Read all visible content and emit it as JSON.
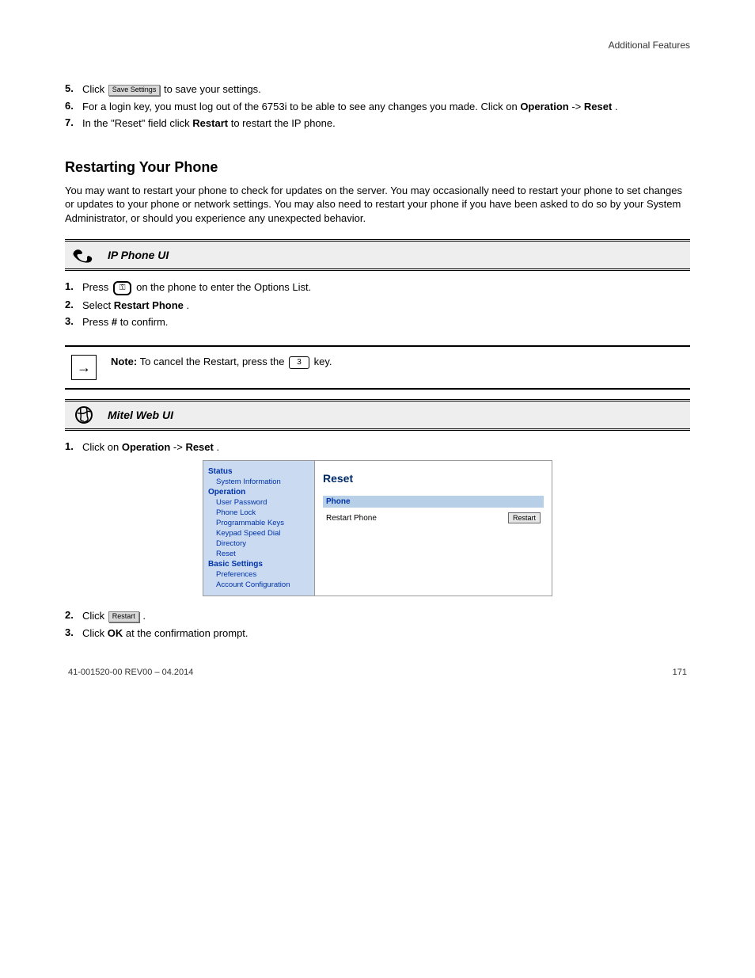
{
  "running_header": "Additional Features",
  "steps_a": [
    {
      "n": "5.",
      "pre": "Click ",
      "btn": "Save Settings",
      "post": " to save your settings."
    },
    {
      "n": "6.",
      "pre": "For a login key, you must log out of the 6753i to be able to see any changes you made. Click on ",
      "strong1": "Operation",
      "mid": "->",
      "strong2": "Reset",
      "post": "."
    },
    {
      "n": "7.",
      "pre": "In the \"Reset\" field click ",
      "strong1": "Restart",
      "post": " to restart the IP phone."
    }
  ],
  "section1": {
    "title": "Restarting Your Phone",
    "desc": "You may want to restart your phone to check for updates on the server. You may occasionally need to restart your phone to set changes or updates to your phone or network settings. You may also need to restart your phone if you have been asked to do so by your System Administrator, or should you experience any unexpected behavior."
  },
  "banner_phone": "IP Phone UI",
  "phone_steps": [
    {
      "n": "1.",
      "pre": "Press ",
      "key": "⚿",
      "post": " on the phone to enter the Options List."
    },
    {
      "n": "2.",
      "pre": "Select ",
      "strong1": "Restart Phone",
      "post": "."
    },
    {
      "n": "3.",
      "pre": "Press ",
      "strong1": "#",
      "post": " to confirm."
    }
  ],
  "note": {
    "lead": "Note:",
    "body": " To cancel the Restart, press the ",
    "key": "3",
    "post": " key."
  },
  "banner_web": "Mitel Web UI",
  "web_step1": {
    "n": "1.",
    "pre": "Click on ",
    "strong1": "Operation",
    "mid": "->",
    "strong2": "Reset",
    "post": "."
  },
  "webui": {
    "side": {
      "groups": [
        {
          "head": "Status",
          "items": [
            "System Information"
          ]
        },
        {
          "head": "Operation",
          "items": [
            "User Password",
            "Phone Lock",
            "Programmable Keys",
            "Keypad Speed Dial",
            "Directory",
            "Reset"
          ]
        },
        {
          "head": "Basic Settings",
          "items": [
            "Preferences",
            "Account Configuration"
          ]
        }
      ]
    },
    "main": {
      "title": "Reset",
      "subhead": "Phone",
      "row_label": "Restart Phone",
      "restart_btn": "Restart"
    }
  },
  "steps_b": [
    {
      "n": "2.",
      "pre": "Click ",
      "btn": "Restart",
      "post": "."
    },
    {
      "n": "3.",
      "pre": "Click ",
      "strong1": "OK",
      "post": " at the confirmation prompt."
    }
  ],
  "footer": {
    "left": "41-001520-00 REV00 – 04.2014",
    "right": "171"
  }
}
